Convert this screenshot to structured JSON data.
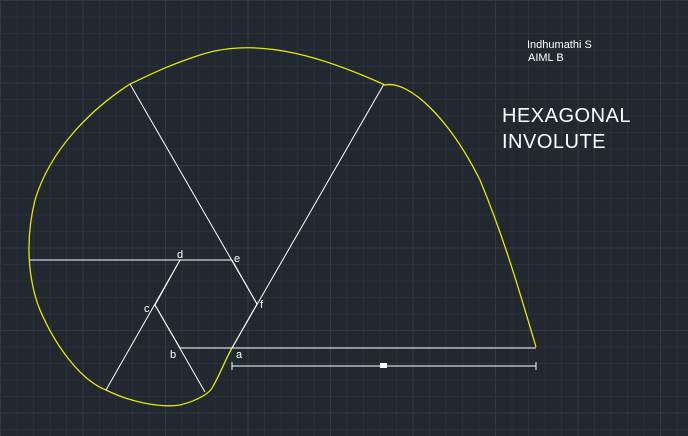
{
  "author": {
    "name": "Indhumathi S",
    "class": "AIML B"
  },
  "title": {
    "line1": "HEXAGONAL",
    "line2": "INVOLUTE"
  },
  "point_labels": {
    "a": "a",
    "b": "b",
    "c": "c",
    "d": "d",
    "e": "e",
    "f": "f"
  },
  "colors": {
    "background": "#212830",
    "grid": "#323a45",
    "involute_curve": "#e8e800",
    "lines": "#ffffff",
    "text": "#ffffff"
  }
}
